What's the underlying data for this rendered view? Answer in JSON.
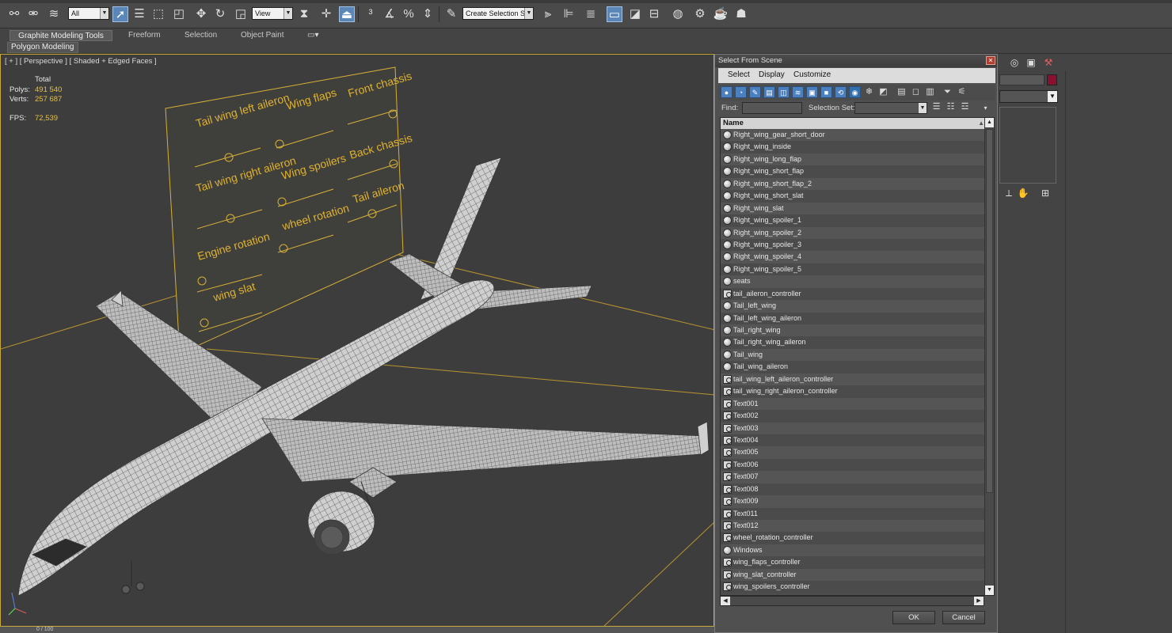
{
  "toolbar": {
    "filter_value": "All",
    "coord_value": "View",
    "selection_set_placeholder": "Create Selection Se"
  },
  "ribbon": {
    "tabs": [
      "Graphite Modeling Tools",
      "Freeform",
      "Selection",
      "Object Paint"
    ],
    "panel_label": "Polygon Modeling"
  },
  "viewport": {
    "label": "[ + ] [ Perspective ] [ Shaded + Edged Faces ]",
    "stats": {
      "total_label": "Total",
      "polys_label": "Polys:",
      "polys_value": "491 540",
      "verts_label": "Verts:",
      "verts_value": "257 687",
      "fps_label": "FPS:",
      "fps_value": "72,539"
    },
    "control_labels": [
      "Tail wing left aileron",
      "Wing flaps",
      "Front chassis",
      "Tail wing right aileron",
      "Wing spoilers",
      "Back chassis",
      "Engine rotation",
      "wheel rotation",
      "Tail aileron",
      "wing slat"
    ],
    "accent_color": "#e0b22e"
  },
  "bottom": {
    "frame_counter": "0 / 100"
  },
  "dialog": {
    "title": "Select From Scene",
    "menu": [
      "Select",
      "Display",
      "Customize"
    ],
    "find_label": "Find:",
    "find_value": "",
    "selection_set_label": "Selection Set:",
    "selection_set_value": "",
    "column_header": "Name",
    "ok_label": "OK",
    "cancel_label": "Cancel",
    "items": [
      {
        "name": "Right_wing_gear_short_door",
        "icon": "sphere-icon"
      },
      {
        "name": "Right_wing_inside",
        "icon": "sphere-icon"
      },
      {
        "name": "Right_wing_long_flap",
        "icon": "sphere-icon"
      },
      {
        "name": "Right_wing_short_flap",
        "icon": "sphere-icon"
      },
      {
        "name": "Right_wing_short_flap_2",
        "icon": "sphere-icon"
      },
      {
        "name": "Right_wing_short_slat",
        "icon": "sphere-icon"
      },
      {
        "name": "Right_wing_slat",
        "icon": "sphere-icon"
      },
      {
        "name": "Right_wing_spoiler_1",
        "icon": "sphere-icon"
      },
      {
        "name": "Right_wing_spoiler_2",
        "icon": "sphere-icon"
      },
      {
        "name": "Right_wing_spoiler_3",
        "icon": "sphere-icon"
      },
      {
        "name": "Right_wing_spoiler_4",
        "icon": "sphere-icon"
      },
      {
        "name": "Right_wing_spoiler_5",
        "icon": "sphere-icon"
      },
      {
        "name": "seats",
        "icon": "sphere-icon"
      },
      {
        "name": "tail_aileron_controller",
        "icon": "shape-icon"
      },
      {
        "name": "Tail_left_wing",
        "icon": "sphere-icon"
      },
      {
        "name": "Tail_left_wing_aileron",
        "icon": "sphere-icon"
      },
      {
        "name": "Tail_right_wing",
        "icon": "sphere-icon"
      },
      {
        "name": "Tail_right_wing_aileron",
        "icon": "sphere-icon"
      },
      {
        "name": "Tail_wing",
        "icon": "sphere-icon"
      },
      {
        "name": "Tail_wing_aileron",
        "icon": "sphere-icon"
      },
      {
        "name": "tail_wing_left_aileron_controller",
        "icon": "shape-icon"
      },
      {
        "name": "tail_wing_right_aileron_controller",
        "icon": "shape-icon"
      },
      {
        "name": "Text001",
        "icon": "shape-icon"
      },
      {
        "name": "Text002",
        "icon": "shape-icon"
      },
      {
        "name": "Text003",
        "icon": "shape-icon"
      },
      {
        "name": "Text004",
        "icon": "shape-icon"
      },
      {
        "name": "Text005",
        "icon": "shape-icon"
      },
      {
        "name": "Text006",
        "icon": "shape-icon"
      },
      {
        "name": "Text007",
        "icon": "shape-icon"
      },
      {
        "name": "Text008",
        "icon": "shape-icon"
      },
      {
        "name": "Text009",
        "icon": "shape-icon"
      },
      {
        "name": "Text011",
        "icon": "shape-icon"
      },
      {
        "name": "Text012",
        "icon": "shape-icon"
      },
      {
        "name": "wheel_rotation_controller",
        "icon": "shape-icon"
      },
      {
        "name": "Windows",
        "icon": "sphere-icon"
      },
      {
        "name": "wing_flaps_controller",
        "icon": "shape-icon"
      },
      {
        "name": "wing_slat_controller",
        "icon": "shape-icon"
      },
      {
        "name": "wing_spoilers_controller",
        "icon": "shape-icon"
      }
    ]
  }
}
